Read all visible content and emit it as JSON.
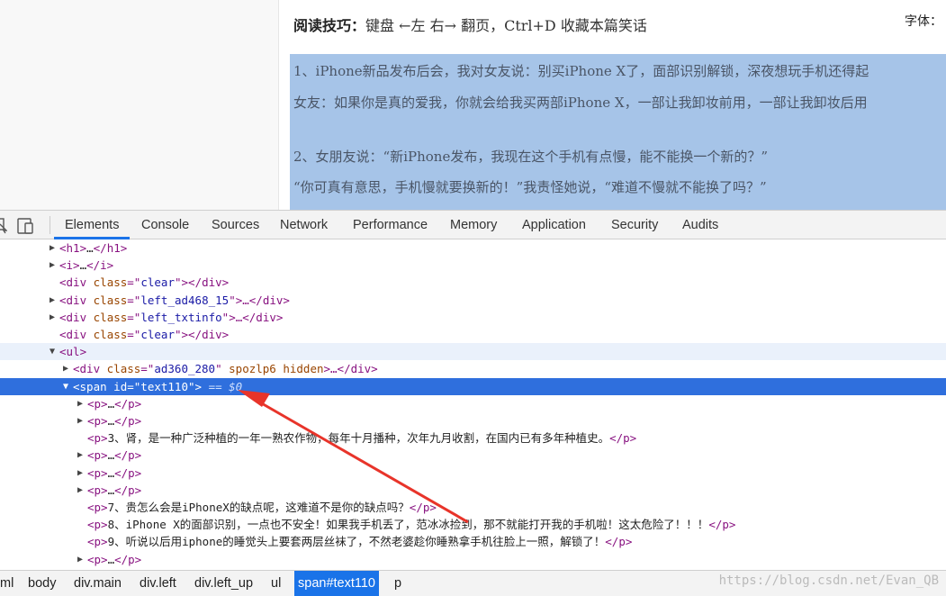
{
  "page": {
    "reading_tip_label": "阅读技巧：",
    "reading_tip_text": "键盘 ←左 右→ 翻页，Ctrl+D 收藏本篇笑话",
    "font_label": "字体：",
    "joke_lines": [
      "1、iPhone新品发布后会，我对女友说：别买iPhone X了，面部识别解锁，深夜想玩手机还得起",
      "女友：如果你是真的爱我，你就会给我买两部iPhone X，一部让我卸妆前用，一部让我卸妆后用",
      "2、女朋友说：“新iPhone发布，我现在这个手机有点慢，能不能换一个新的？”",
      "“你可真有意思，手机慢就要换新的！”我责怪她说，“难道不慢就不能换了吗？”"
    ]
  },
  "devtools": {
    "tabs": [
      "Elements",
      "Console",
      "Sources",
      "Network",
      "Performance",
      "Memory",
      "Application",
      "Security",
      "Audits"
    ],
    "active_tab": "Elements",
    "rows": [
      {
        "tri": "▶",
        "open": "<h1>",
        "mid": "…",
        "close": "</h1>"
      },
      {
        "tri": "▶",
        "open": "<i>",
        "mid": "…",
        "close": "</i>"
      },
      {
        "tri": "",
        "tag": "div",
        "attr": "class",
        "val": "clear",
        "suffix": "></div>"
      },
      {
        "tri": "▶",
        "tag": "div",
        "attr": "class",
        "val": "left_ad468_15",
        "suffix": ">…</div>"
      },
      {
        "tri": "▶",
        "tag": "div",
        "attr": "class",
        "val": "left_txtinfo",
        "suffix": ">…</div>"
      },
      {
        "tri": "",
        "tag": "div",
        "attr": "class",
        "val": "clear",
        "suffix": "></div>"
      },
      {
        "tri": "▼",
        "open": "<ul>",
        "mid": "",
        "close": ""
      },
      {
        "tri": "▶",
        "tag": "div",
        "attr": "class",
        "val": "ad360_280",
        "extra": "spozlp6 hidden",
        "suffix": ">…</div>"
      },
      {
        "tri": "▼",
        "tag": "span",
        "attr": "id",
        "val": "text110",
        "suffix": ">",
        "dollar": "== $0"
      },
      {
        "tri": "▶",
        "open": "<p>",
        "mid": "…",
        "close": "</p>"
      },
      {
        "tri": "▶",
        "open": "<p>",
        "mid": "…",
        "close": "</p>"
      },
      {
        "tri": "",
        "open": "<p>",
        "mid": "3、肾，是一种广泛种植的一年一熟农作物，每年十月播种，次年九月收割，在国内已有多年种植史。",
        "close": "</p>"
      },
      {
        "tri": "▶",
        "open": "<p>",
        "mid": "…",
        "close": "</p>"
      },
      {
        "tri": "▶",
        "open": "<p>",
        "mid": "…",
        "close": "</p>"
      },
      {
        "tri": "▶",
        "open": "<p>",
        "mid": "…",
        "close": "</p>"
      },
      {
        "tri": "",
        "open": "<p>",
        "mid": "7、贵怎么会是iPhoneX的缺点呢，这难道不是你的缺点吗？",
        "close": "</p>"
      },
      {
        "tri": "",
        "open": "<p>",
        "mid": "8、iPhone X的面部识别，一点也不安全！如果我手机丢了，范冰冰捡到，那不就能打开我的手机啦！这太危险了！！！",
        "close": "</p>"
      },
      {
        "tri": "",
        "open": "<p>",
        "mid": "9、听说以后用iphone的睡觉头上要套两层丝袜了，不然老婆趁你睡熟拿手机往脸上一照，解锁了！",
        "close": "</p>"
      },
      {
        "tri": "▶",
        "open": "<p>",
        "mid": "…",
        "close": "</p>"
      }
    ],
    "breadcrumbs": [
      "ml",
      "body",
      "div.main",
      "div.left",
      "div.left_up",
      "ul",
      "span#text110",
      "p"
    ],
    "active_breadcrumb": "span#text110",
    "watermark": "https://blog.csdn.net/Evan_QB"
  },
  "colors": {
    "selection": "#2f6fdd",
    "accent": "#1a73e8",
    "annotation_arrow": "#e8342a",
    "page_highlight": "#a6c4e8"
  }
}
